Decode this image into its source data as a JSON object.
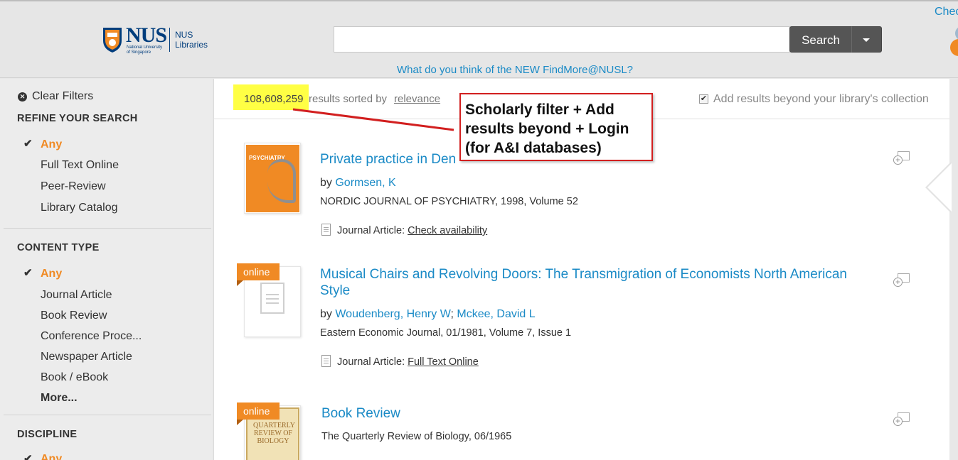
{
  "header": {
    "logo_text": "NUS",
    "logo_subtext": "National University of Singapore",
    "libraries_text": "NUS\nLibraries",
    "search_value": "",
    "search_button": "Search",
    "feedback_link": "What do you think of the NEW FindMore@NUSL?",
    "check_link": "Chec"
  },
  "sidebar": {
    "clear_filters": "Clear Filters",
    "refine": {
      "title": "REFINE YOUR SEARCH",
      "items": [
        "Any",
        "Full Text Online",
        "Peer-Review",
        "Library Catalog"
      ]
    },
    "content_type": {
      "title": "CONTENT TYPE",
      "items": [
        "Any",
        "Journal Article",
        "Book Review",
        "Conference Proce...",
        "Newspaper Article",
        "Book / eBook",
        "More..."
      ]
    },
    "discipline": {
      "title": "DISCIPLINE",
      "items": [
        "Any"
      ]
    }
  },
  "results_bar": {
    "count": "108,608,259",
    "sorted_text": "results sorted by",
    "sort_link": "relevance",
    "beyond_label": "Add results beyond your library's collection",
    "beyond_checked": true
  },
  "results": [
    {
      "title": "Private practice in Den",
      "by": "by",
      "authors": [
        "Gormsen, K"
      ],
      "source": "NORDIC JOURNAL OF PSYCHIATRY, 1998, Volume 52",
      "format": "Journal Article:",
      "link": "Check availability",
      "thumb_text": "PSYCHIATRY",
      "online": false
    },
    {
      "title": "Musical Chairs and Revolving Doors: The Transmigration of Economists North American Style",
      "by": "by",
      "authors": [
        "Woudenberg, Henry W",
        "Mckee, David L"
      ],
      "source": "Eastern Economic Journal, 01/1981, Volume 7, Issue 1",
      "format": "Journal Article:",
      "link": "Full Text Online",
      "online": true,
      "online_label": "online"
    },
    {
      "title": "Book Review",
      "source": "The Quarterly Review of Biology, 06/1965",
      "online": true,
      "online_label": "online",
      "thumb_text": "QUARTERLY REVIEW OF BIOLOGY"
    }
  ],
  "annotation": {
    "text": "Scholarly filter + Add results beyond + Login (for A&I databases)",
    "border_color": "#d21f1f",
    "highlight_color": "#ffff44"
  },
  "colors": {
    "accent_orange": "#f08a24",
    "link_blue": "#1a8ac6",
    "brand_navy": "#003d7c"
  }
}
